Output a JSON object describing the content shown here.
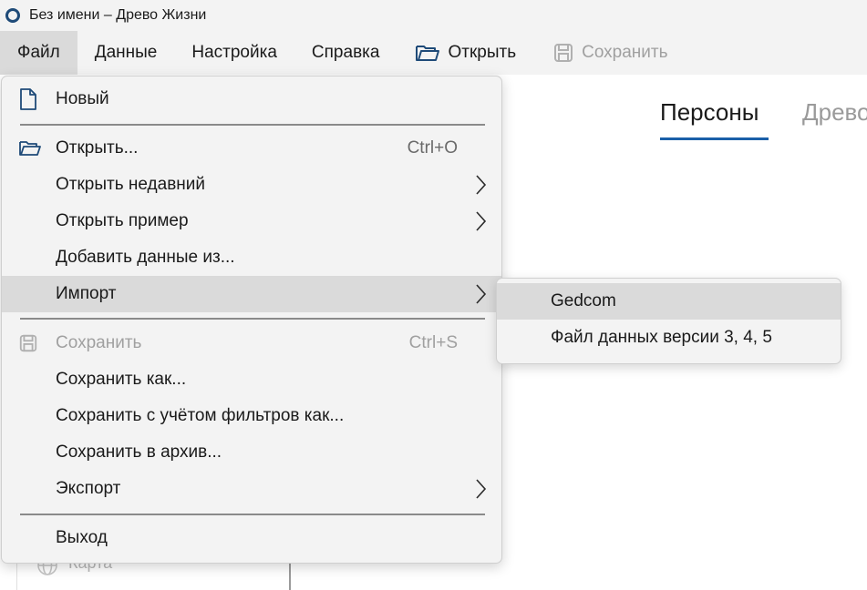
{
  "window": {
    "title": "Без имени – Древо Жизни"
  },
  "menubar": {
    "file": "Файл",
    "data": "Данные",
    "settings": "Настройка",
    "help": "Справка",
    "open_tool": "Открыть",
    "save_tool": "Сохранить"
  },
  "tabs": {
    "persons": "Персоны",
    "tree": "Древо"
  },
  "background_panel": {
    "map_label": "Карта"
  },
  "file_menu": {
    "new": "Новый",
    "open": "Открыть...",
    "open_shortcut": "Ctrl+O",
    "open_recent": "Открыть недавний",
    "open_sample": "Открыть пример",
    "add_data": "Добавить данные из...",
    "import": "Импорт",
    "save": "Сохранить",
    "save_shortcut": "Ctrl+S",
    "save_as": "Сохранить как...",
    "save_filtered": "Сохранить с учётом фильтров как...",
    "save_archive": "Сохранить в архив...",
    "export": "Экспорт",
    "exit": "Выход"
  },
  "import_submenu": {
    "gedcom": "Gedcom",
    "legacy": "Файл данных версии 3, 4, 5"
  },
  "colors": {
    "accent": "#1a5fa8",
    "highlight": "#dadada",
    "menu_bg": "#f3f3f3"
  }
}
